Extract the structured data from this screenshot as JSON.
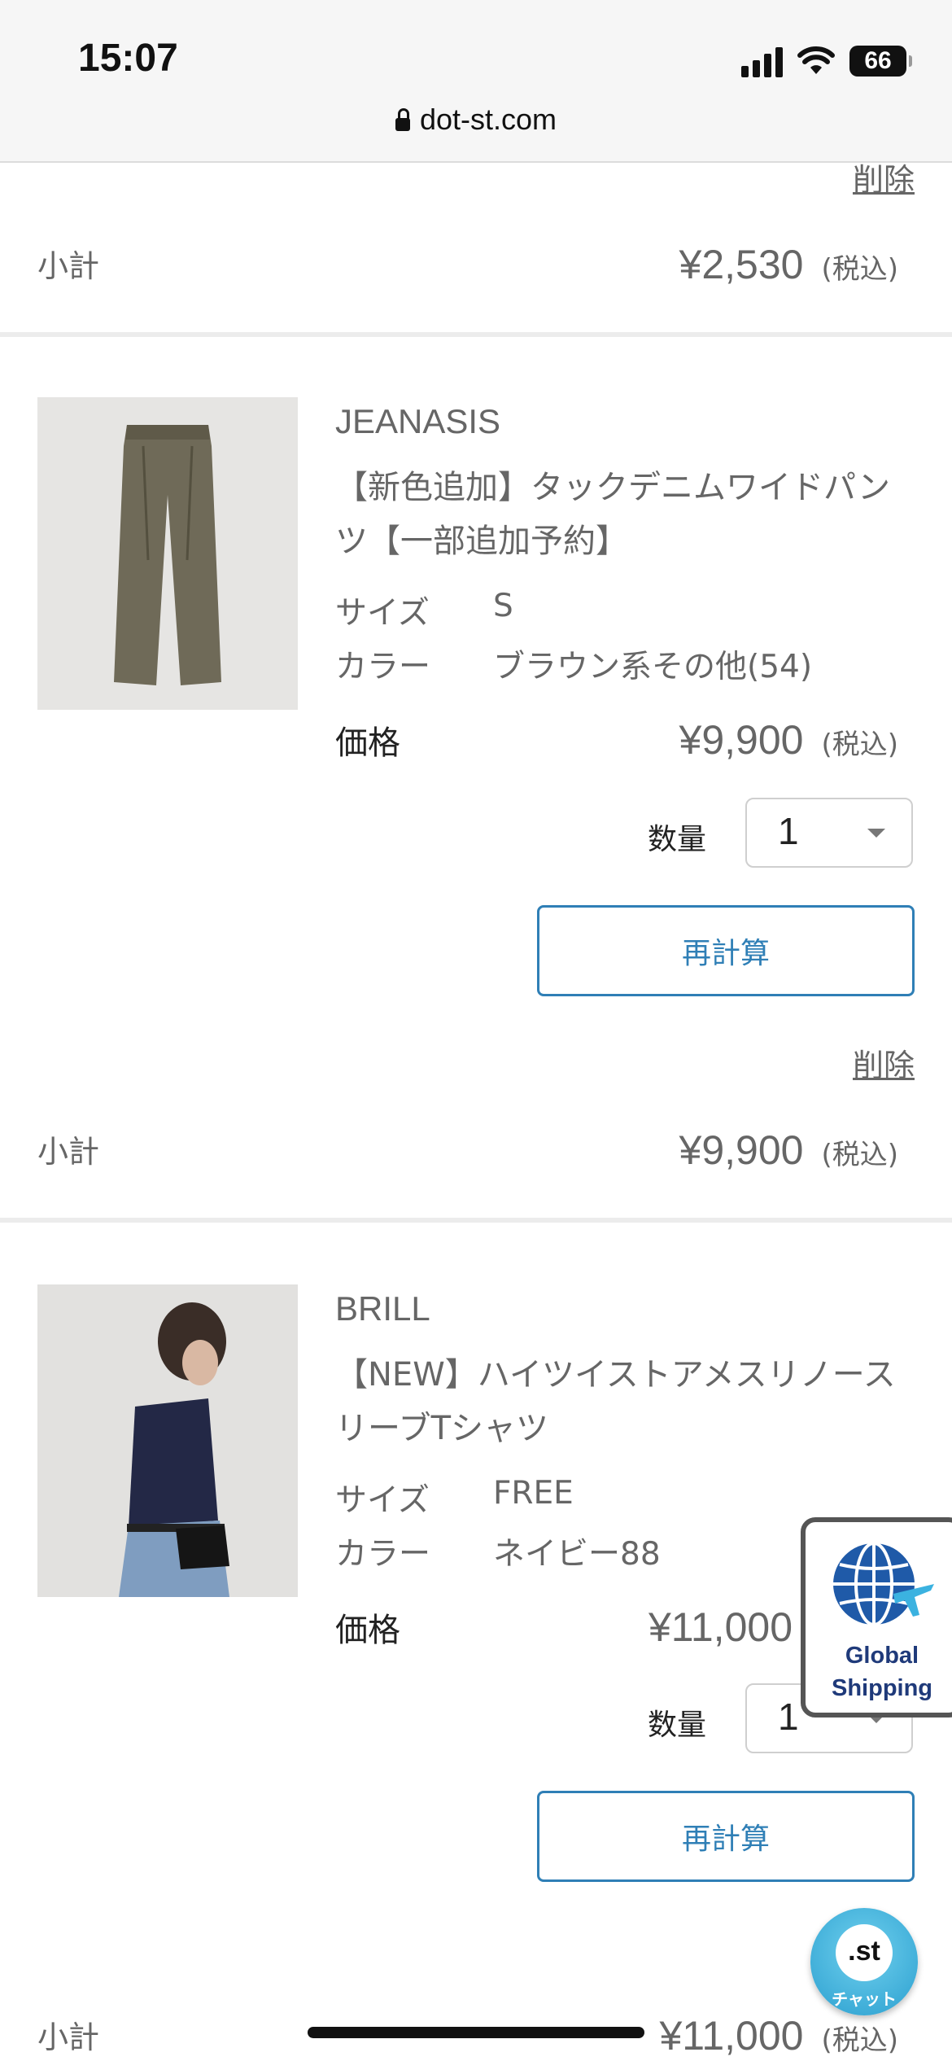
{
  "status_bar": {
    "time": "15:07",
    "battery": "66",
    "icons": [
      "signal-icon",
      "wifi-icon",
      "battery-icon"
    ]
  },
  "browser": {
    "url": "dot-st.com",
    "lock_icon": "lock-icon"
  },
  "prev_item": {
    "delete_label": "削除",
    "subtotal_label": "小計",
    "subtotal": "¥2,530",
    "tax_label": "(税込)"
  },
  "items": [
    {
      "brand": "JEANASIS",
      "title": "【新色追加】タックデニムワイドパンツ【一部追加予約】",
      "size_label": "サイズ",
      "size": "S",
      "color_label": "カラー",
      "color": "ブラウン系その他(54)",
      "price_label": "価格",
      "price": "¥9,900",
      "tax_label": "(税込)",
      "qty_label": "数量",
      "qty": "1",
      "recalc_label": "再計算",
      "delete_label": "削除",
      "subtotal_label": "小計",
      "subtotal": "¥9,900"
    },
    {
      "brand": "BRILL",
      "title": "【NEW】ハイツイストアメスリノースリーブTシャツ",
      "size_label": "サイズ",
      "size": "FREE",
      "color_label": "カラー",
      "color": "ネイビー88",
      "price_label": "価格",
      "price": "¥11,000",
      "qty_label": "数量",
      "qty": "1",
      "recalc_label": "再計算",
      "subtotal_label": "小計",
      "subtotal": "¥11,000",
      "tax_label": "(税込)"
    }
  ],
  "global_shipping": {
    "line1": "Global",
    "line2": "Shipping",
    "icon": "globe-plane-icon"
  },
  "chat": {
    "logo": ".st",
    "label": "チャット",
    "icon": "headset-icon"
  },
  "colors": {
    "accent_blue": "#2f7fb6",
    "text_gray": "#666666",
    "divider": "#ececec"
  }
}
